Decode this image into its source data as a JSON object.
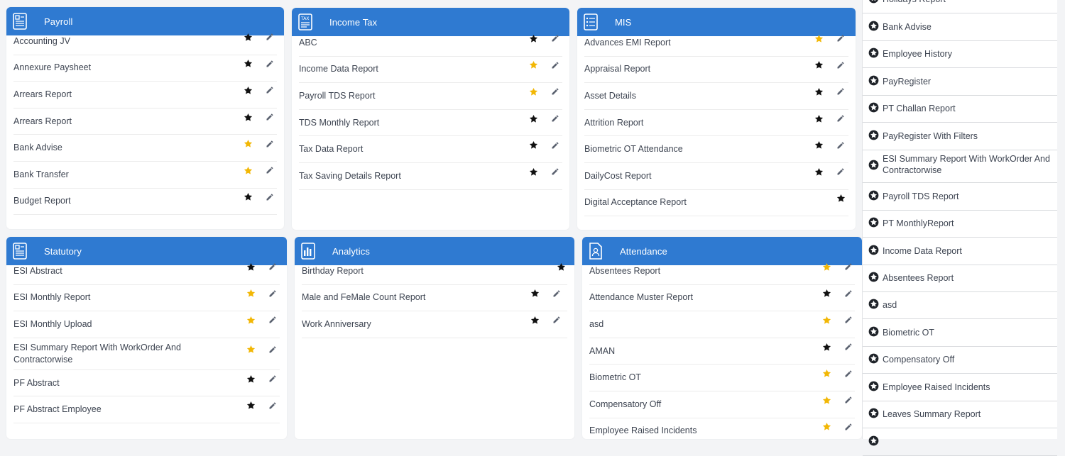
{
  "colors": {
    "header": "#2f7ad1",
    "star_gold": "#f2b705",
    "star_black": "#111111",
    "pencil": "#5b6270"
  },
  "cards": [
    {
      "key": "payroll",
      "title": "Payroll",
      "icon": "document-icon",
      "rows": [
        {
          "label": "Accounting JV",
          "fav": false
        },
        {
          "label": "Annexure Paysheet",
          "fav": false
        },
        {
          "label": "Arrears Report",
          "fav": false
        },
        {
          "label": "Arrears Report",
          "fav": false
        },
        {
          "label": "Bank Advise",
          "fav": true
        },
        {
          "label": "Bank Transfer",
          "fav": true
        },
        {
          "label": "Budget Report",
          "fav": false
        }
      ]
    },
    {
      "key": "income-tax",
      "title": "Income Tax",
      "icon": "tax-document-icon",
      "rows": [
        {
          "label": "ABC",
          "fav": false
        },
        {
          "label": "Income Data Report",
          "fav": true
        },
        {
          "label": "Payroll TDS Report",
          "fav": true
        },
        {
          "label": "TDS Monthly Report",
          "fav": false
        },
        {
          "label": "Tax Data Report",
          "fav": false
        },
        {
          "label": "Tax Saving Details Report",
          "fav": false
        }
      ]
    },
    {
      "key": "mis",
      "title": "MIS",
      "icon": "document-list-icon",
      "rows": [
        {
          "label": "Advances EMI Report",
          "fav": true
        },
        {
          "label": "Appraisal Report",
          "fav": false
        },
        {
          "label": "Asset Details",
          "fav": false
        },
        {
          "label": "Attrition Report",
          "fav": false
        },
        {
          "label": "Biometric OT Attendance",
          "fav": false
        },
        {
          "label": "DailyCost Report",
          "fav": false
        },
        {
          "label": "Digital Acceptance Report",
          "fav": false
        }
      ]
    },
    {
      "key": "statutory",
      "title": "Statutory",
      "icon": "document-icon",
      "rows": [
        {
          "label": "ESI Abstract",
          "fav": false
        },
        {
          "label": "ESI Monthly Report",
          "fav": true
        },
        {
          "label": "ESI Monthly Upload",
          "fav": true
        },
        {
          "label": "ESI Summary Report With WorkOrder And Contractorwise",
          "fav": true
        },
        {
          "label": "PF Abstract",
          "fav": false
        },
        {
          "label": "PF Abstract Employee",
          "fav": false
        }
      ]
    },
    {
      "key": "analytics",
      "title": "Analytics",
      "icon": "bar-chart-document-icon",
      "rows": [
        {
          "label": "Birthday Report",
          "fav": false
        },
        {
          "label": "Male and FeMale Count Report",
          "fav": false
        },
        {
          "label": "Work Anniversary",
          "fav": false
        }
      ]
    },
    {
      "key": "attendance",
      "title": "Attendance",
      "icon": "person-document-icon",
      "rows": [
        {
          "label": "Absentees Report",
          "fav": true
        },
        {
          "label": "Attendance Muster Report",
          "fav": false
        },
        {
          "label": "asd",
          "fav": true
        },
        {
          "label": "AMAN",
          "fav": false
        },
        {
          "label": "Biometric OT",
          "fav": true
        },
        {
          "label": "Compensatory Off",
          "fav": true
        },
        {
          "label": "Employee Raised Incidents",
          "fav": true
        }
      ]
    }
  ],
  "sidebar": {
    "items": [
      {
        "label": "Holidays Report"
      },
      {
        "label": "Bank Advise"
      },
      {
        "label": "Employee History"
      },
      {
        "label": "PayRegister"
      },
      {
        "label": "PT Challan Report"
      },
      {
        "label": "PayRegister With Filters"
      },
      {
        "label": "ESI Summary Report With WorkOrder And Contractorwise"
      },
      {
        "label": "Payroll TDS Report"
      },
      {
        "label": "PT MonthlyReport"
      },
      {
        "label": "Income Data Report"
      },
      {
        "label": "Absentees Report"
      },
      {
        "label": "asd"
      },
      {
        "label": "Biometric OT"
      },
      {
        "label": "Compensatory Off"
      },
      {
        "label": "Employee Raised Incidents"
      },
      {
        "label": "Leaves Summary Report"
      },
      {
        "label": ""
      }
    ]
  }
}
